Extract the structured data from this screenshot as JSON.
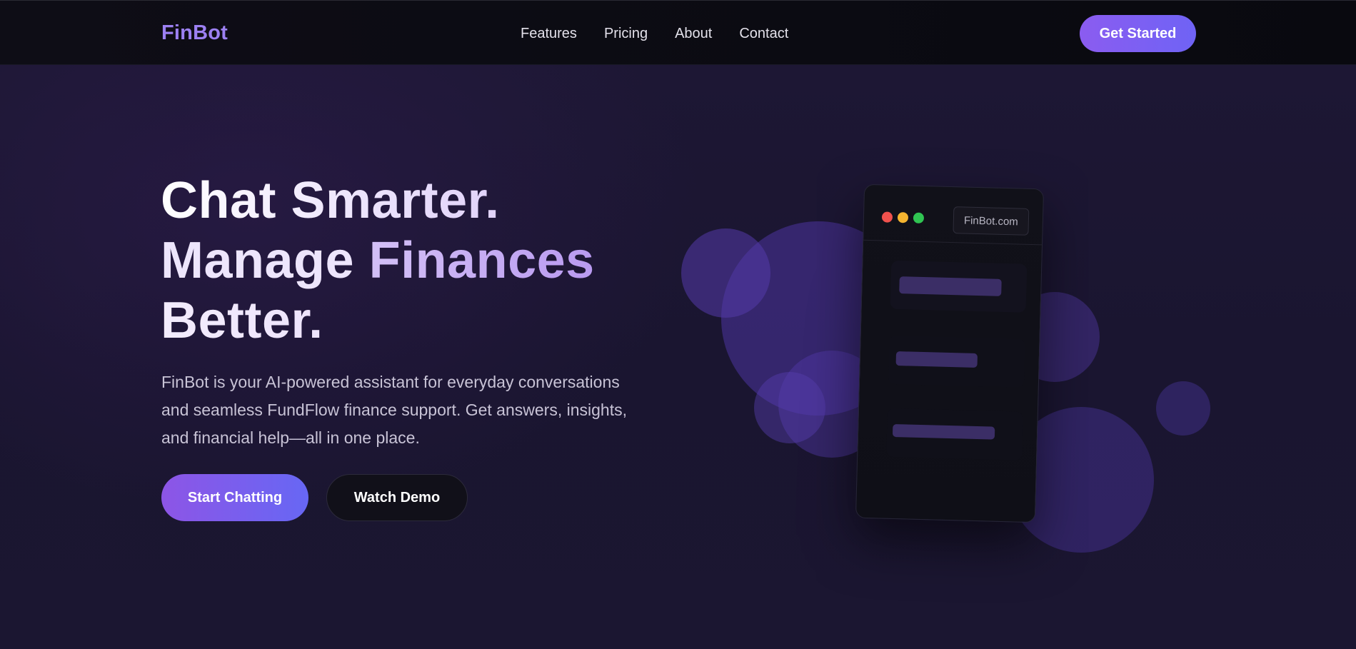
{
  "nav": {
    "brand": "FinBot",
    "links": [
      "Features",
      "Pricing",
      "About",
      "Contact"
    ],
    "cta": "Get Started"
  },
  "hero": {
    "headline": {
      "line1": "Chat Smarter.",
      "line2_a": "Manage",
      "line2_b": "Finances",
      "line3": "Better."
    },
    "subtitle": "FinBot is your AI-powered assistant for everyday conversations and seamless FundFlow finance support. Get answers, insights, and financial help—all in one place.",
    "primary_cta": "Start Chatting",
    "secondary_cta": "Watch Demo"
  },
  "mockup": {
    "url": "FinBot.com",
    "window_dots": [
      "#f0514d",
      "#f4b430",
      "#30c452"
    ]
  },
  "colors": {
    "brand": "#9c80f2",
    "accent_start": "#8b5cf0",
    "accent_end": "#6f63f5",
    "background": "#1a1530",
    "nav_background": "#0b0b12"
  }
}
